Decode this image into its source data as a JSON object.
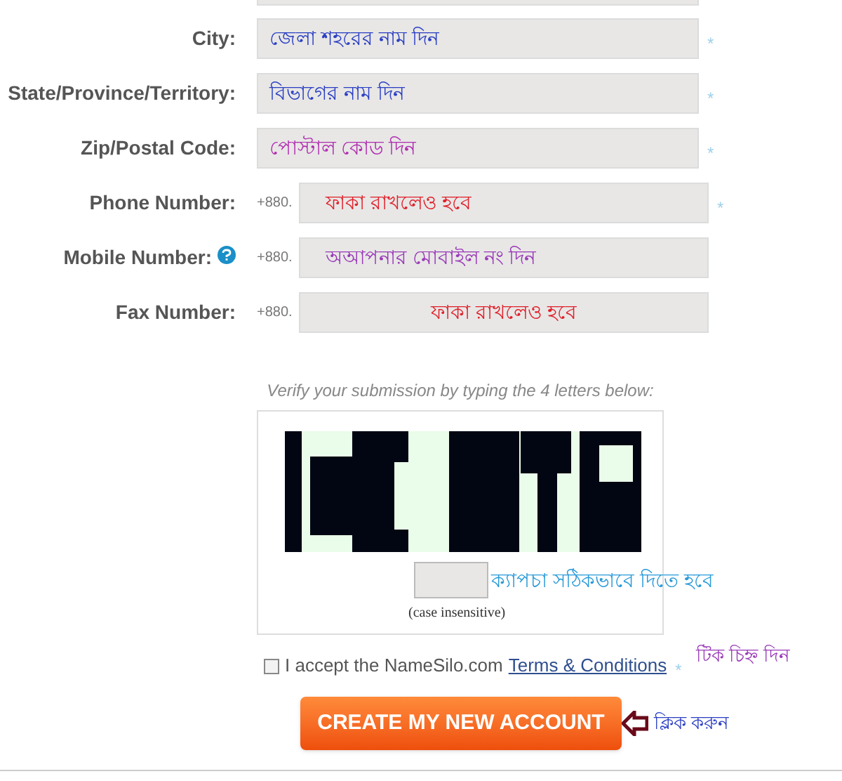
{
  "address_fields": [
    {
      "label": "City:",
      "value": "জেলা শহরের নাম দিন",
      "color": "#2b3fc4",
      "required_mark": "*"
    },
    {
      "label": "State/Province/Territory:",
      "value": "বিভাগের নাম দিন",
      "color": "#2b3fc4",
      "required_mark": "*"
    },
    {
      "label": "Zip/Postal Code:",
      "value": "পোস্টাল কোড দিন",
      "color": "#b02fb0",
      "required_mark": "*"
    }
  ],
  "phone_fields": [
    {
      "label": "Phone Number:",
      "prefix": "+880.",
      "value": "ফাকা রাখলেও হবে",
      "color": "#e0202a",
      "required_mark": "*"
    },
    {
      "label": "Mobile Number:",
      "prefix": "+880.",
      "value": "অআপনার মোবাইল নং দিন",
      "color": "#9a3ab8",
      "help": true
    },
    {
      "label": "Fax Number:",
      "prefix": "+880.",
      "value": "ফাকা রাখলেও হবে",
      "color": "#e0202a"
    }
  ],
  "captcha": {
    "prompt": "Verify your submission by typing the 4 letters below:",
    "note": "ক্যাপচা সঠিকভাবে দিতে হবে",
    "hint": "(case insensitive)"
  },
  "terms": {
    "checked": false,
    "text": "I accept the NameSilo.com",
    "link": "Terms & Conditions",
    "required_mark": "*",
    "note": "টিক চিহ্ন দিন"
  },
  "submit": {
    "label": "CREATE MY NEW ACCOUNT",
    "note": "ক্লিক করুন"
  }
}
